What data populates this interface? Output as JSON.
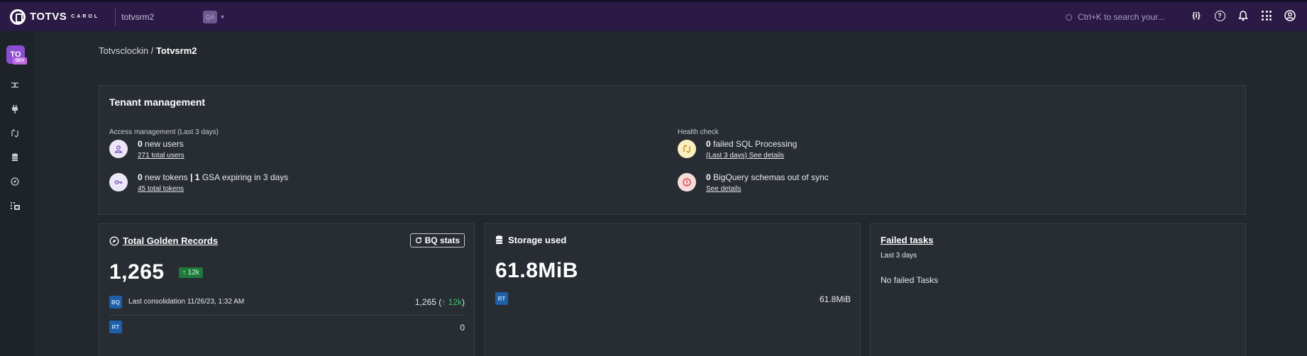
{
  "topbar": {
    "logo_text": "TOTVS",
    "logo_sub": "CAROL",
    "tenant": "totvsrm2",
    "env_chip": "QA",
    "search_placeholder": "Ctrl+K to search your...",
    "icons": [
      "api-icon",
      "help-icon",
      "bell-icon",
      "apps-grid-icon",
      "user-icon"
    ]
  },
  "sidebar": {
    "avatar": "TO",
    "avatar_env": "DEV",
    "items": [
      "connectors-icon",
      "plug-icon",
      "data-flow-icon",
      "database-icon",
      "explore-icon",
      "apps-icon"
    ]
  },
  "breadcrumb": {
    "parent": "Totvsclockin",
    "separator": "/",
    "current": "Totvsrm2"
  },
  "tenant_management": {
    "title": "Tenant management",
    "access": {
      "label": "Access management (Last 3 days)",
      "users_count": "0",
      "users_text": "new users",
      "users_link": "271 total users",
      "tokens_count": "0",
      "tokens_text": "new tokens",
      "gsa_count": "1",
      "gsa_text": "GSA expiring in 3 days",
      "tokens_link": "45 total tokens"
    },
    "health": {
      "label": "Health check",
      "sql_count": "0",
      "sql_text": "failed SQL Processing",
      "sql_link": "(Last 3 days) See details",
      "bq_count": "0",
      "bq_text": "BigQuery schemas out of sync",
      "bq_link": "See details"
    }
  },
  "golden_records": {
    "title": "Total Golden Records",
    "button": "BQ stats",
    "total": "1,265",
    "delta": "12k",
    "bq_tag": "BQ",
    "bq_label": "Last consolidation 11/26/23, 1:32 AM",
    "bq_value": "1,265",
    "bq_delta": "12k",
    "rt_tag": "RT",
    "rt_value": "0"
  },
  "storage": {
    "title": "Storage used",
    "total": "61.8MiB",
    "rt_tag": "RT",
    "rt_value": "61.8MiB"
  },
  "failed_tasks": {
    "title": "Failed tasks",
    "subtitle": "Last 3 days",
    "message": "No failed Tasks"
  },
  "colors": {
    "topbar": "#2a1a45",
    "background": "#22282d",
    "panel": "#272d33",
    "accent_green": "#1e7a3a",
    "tag_blue": "#1e5fa8"
  }
}
